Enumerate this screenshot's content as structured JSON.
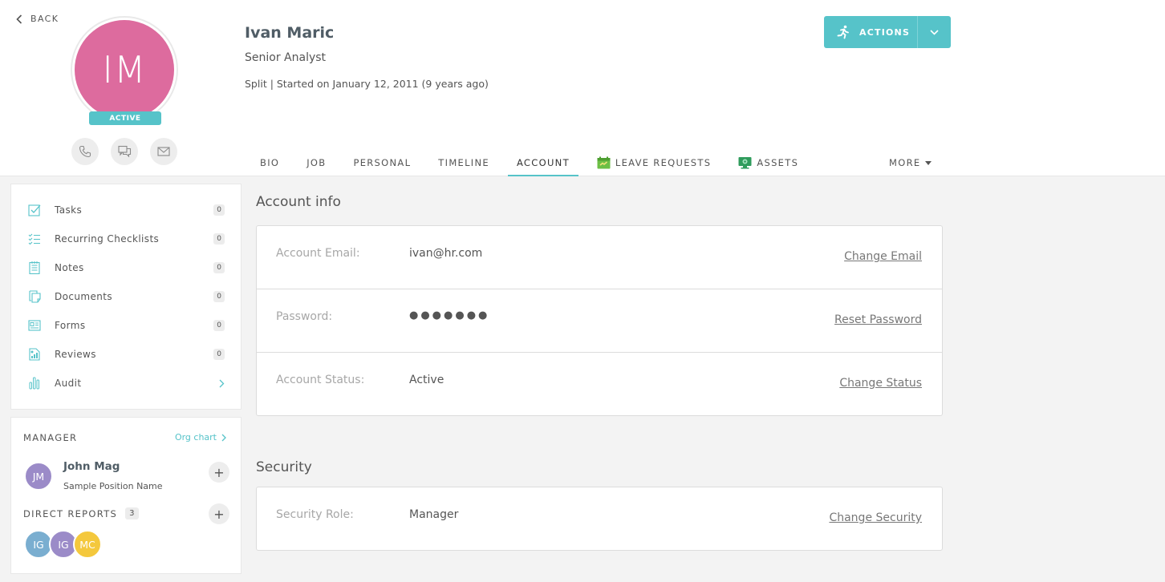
{
  "nav": {
    "back_label": "BACK"
  },
  "profile": {
    "initials": "IM",
    "status": "ACTIVE",
    "name": "Ivan Maric",
    "title": "Senior Analyst",
    "meta": "Split | Started on January 12, 2011 (9 years ago)",
    "avatar_color": "#dd6b9e"
  },
  "actions": {
    "label": "ACTIONS"
  },
  "tabs": [
    {
      "label": "BIO"
    },
    {
      "label": "JOB"
    },
    {
      "label": "PERSONAL"
    },
    {
      "label": "TIMELINE"
    },
    {
      "label": "ACCOUNT",
      "active": true
    },
    {
      "label": "LEAVE REQUESTS",
      "icon": "calendar-icon"
    },
    {
      "label": "ASSETS",
      "icon": "monitor-icon"
    }
  ],
  "more": {
    "label": "MORE"
  },
  "sidebar": {
    "items": [
      {
        "label": "Tasks",
        "count": "0",
        "icon": "checkbox-icon"
      },
      {
        "label": "Recurring Checklists",
        "count": "0",
        "icon": "checklist-icon"
      },
      {
        "label": "Notes",
        "count": "0",
        "icon": "notes-icon"
      },
      {
        "label": "Documents",
        "count": "0",
        "icon": "documents-icon"
      },
      {
        "label": "Forms",
        "count": "0",
        "icon": "forms-icon"
      },
      {
        "label": "Reviews",
        "count": "0",
        "icon": "reviews-icon"
      },
      {
        "label": "Audit",
        "icon": "audit-icon"
      }
    ]
  },
  "manager": {
    "heading": "MANAGER",
    "org_chart": "Org chart",
    "initials": "JM",
    "name": "John Mag",
    "position": "Sample Position Name",
    "reports_heading": "DIRECT REPORTS",
    "reports_count": "3",
    "reports": [
      {
        "initials": "IG",
        "color": "#7aaed0"
      },
      {
        "initials": "IG",
        "color": "#9b8bc8"
      },
      {
        "initials": "MC",
        "color": "#f4c83d"
      }
    ]
  },
  "account": {
    "heading": "Account info",
    "rows": [
      {
        "key": "Account Email:",
        "value": "ivan@hr.com",
        "link": "Change Email"
      },
      {
        "key": "Password:",
        "value": "●●●●●●●",
        "link": "Reset Password"
      },
      {
        "key": "Account Status:",
        "value": "Active",
        "link": "Change Status"
      }
    ]
  },
  "security": {
    "heading": "Security",
    "rows": [
      {
        "key": "Security Role:",
        "value": "Manager",
        "link": "Change Security"
      }
    ]
  },
  "colors": {
    "accent": "#56c3c9",
    "avatar": "#dd6b9e"
  }
}
